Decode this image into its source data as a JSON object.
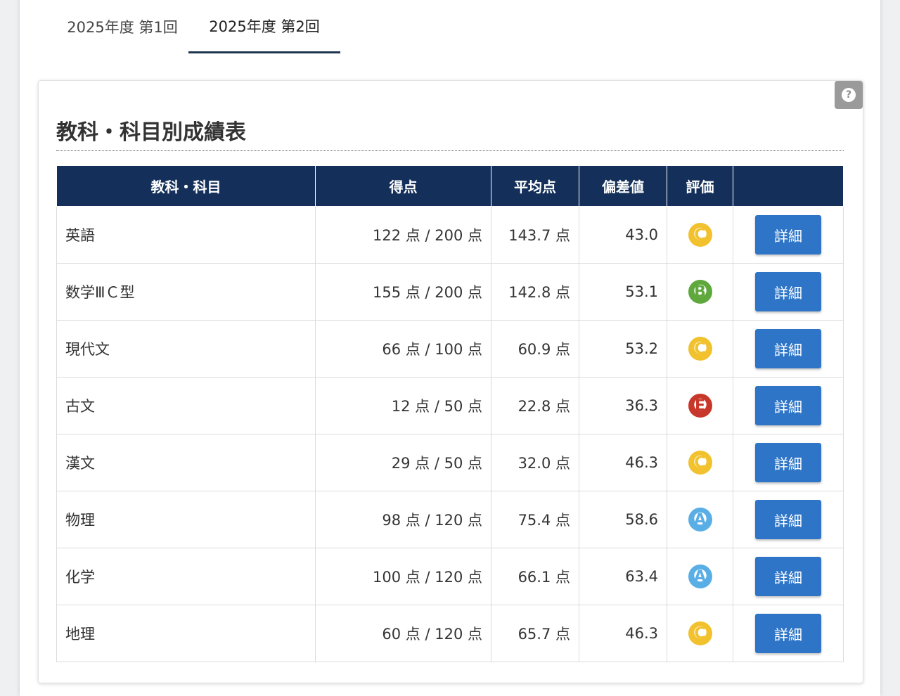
{
  "tabs": [
    {
      "label": "2025年度 第1回"
    },
    {
      "label": "2025年度 第2回"
    }
  ],
  "card": {
    "title": "教科・科目別成績表",
    "help_icon": "question-circle-icon"
  },
  "table": {
    "headers": [
      "教科・科目",
      "得点",
      "平均点",
      "偏差値",
      "評価",
      ""
    ],
    "rows": [
      {
        "subject": "英語",
        "score": "122 点 / 200 点",
        "average": "143.7 点",
        "deviation": "43.0",
        "grade": "C",
        "grade_color": "#f2c12e",
        "button": "詳細"
      },
      {
        "subject": "数学ⅢＣ型",
        "score": "155 点 / 200 点",
        "average": "142.8 点",
        "deviation": "53.1",
        "grade": "B",
        "grade_color": "#5fa83c",
        "button": "詳細"
      },
      {
        "subject": "現代文",
        "score": "66 点 / 100 点",
        "average": "60.9 点",
        "deviation": "53.2",
        "grade": "C",
        "grade_color": "#f2c12e",
        "button": "詳細"
      },
      {
        "subject": "古文",
        "score": "12 点 / 50 点",
        "average": "22.8 点",
        "deviation": "36.3",
        "grade": "E",
        "grade_color": "#c8382a",
        "button": "詳細"
      },
      {
        "subject": "漢文",
        "score": "29 点 / 50 点",
        "average": "32.0 点",
        "deviation": "46.3",
        "grade": "C",
        "grade_color": "#f2c12e",
        "button": "詳細"
      },
      {
        "subject": "物理",
        "score": "98 点 / 120 点",
        "average": "75.4 点",
        "deviation": "58.6",
        "grade": "A",
        "grade_color": "#5aaee6",
        "button": "詳細"
      },
      {
        "subject": "化学",
        "score": "100 点 / 120 点",
        "average": "66.1 点",
        "deviation": "63.4",
        "grade": "A",
        "grade_color": "#5aaee6",
        "button": "詳細"
      },
      {
        "subject": "地理",
        "score": "60 点 / 120 点",
        "average": "65.7 点",
        "deviation": "46.3",
        "grade": "C",
        "grade_color": "#f2c12e",
        "button": "詳細"
      }
    ]
  },
  "colors": {
    "header_bg": "#14305a",
    "button_bg": "#2f75c7",
    "tab_active_border": "#1f3550"
  }
}
